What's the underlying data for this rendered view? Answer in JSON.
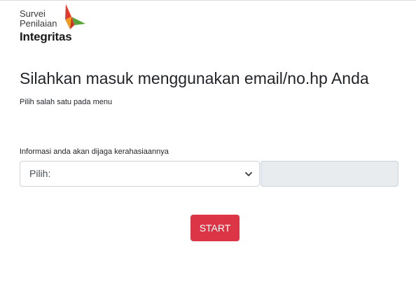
{
  "logo": {
    "line1": "Survei",
    "line2": "Penilaian",
    "line3": "Integritas",
    "colors": {
      "red": "#e03a2f",
      "green": "#5aa23a",
      "orange": "#f39a1c",
      "dark": "#1b1b1b"
    }
  },
  "heading": "Silahkan masuk menggunakan email/no.hp Anda",
  "subheading": "Pilih salah satu pada menu",
  "info_label": "Informasi anda akan dijaga kerahasiaannya",
  "select": {
    "value": "Pilih:",
    "icon": "chevron-down-icon"
  },
  "input": {
    "value": "",
    "placeholder": ""
  },
  "start_button": {
    "label": "START",
    "color": "#dc3545"
  }
}
